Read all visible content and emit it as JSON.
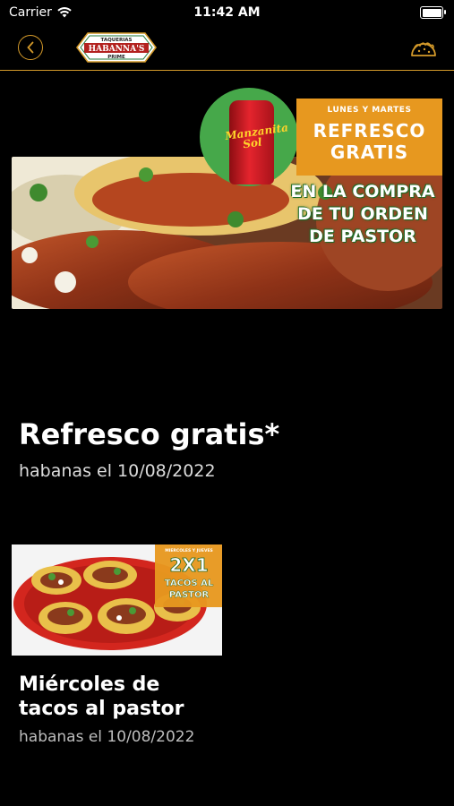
{
  "status_bar": {
    "carrier": "Carrier",
    "time": "11:42 AM"
  },
  "header": {
    "logo": {
      "top": "TAQUERIAS",
      "main": "HABANNA'S",
      "bottom": "PRIME"
    }
  },
  "featured": {
    "banner": {
      "can_brand": "Manzanita Sol",
      "promo_days": "LUNES Y MARTES",
      "promo_line1": "REFRESCO",
      "promo_line2": "GRATIS",
      "promo_detail1": "EN LA COMPRA",
      "promo_detail2": "DE TU ORDEN",
      "promo_detail3": "DE PASTOR"
    },
    "title": "Refresco gratis*",
    "meta": "habanas el 10/08/2022"
  },
  "card": {
    "thumb": {
      "days": "MIERCOLES Y JUEVES",
      "big": "2X1",
      "line1": "TACOS AL",
      "line2": "PASTOR"
    },
    "title_line1": "Miércoles de",
    "title_line2": "tacos al pastor",
    "meta": "habanas el 10/08/2022"
  },
  "colors": {
    "accent": "#d49a2a",
    "promo_orange": "#e7981f",
    "can_green": "#46a84a"
  }
}
